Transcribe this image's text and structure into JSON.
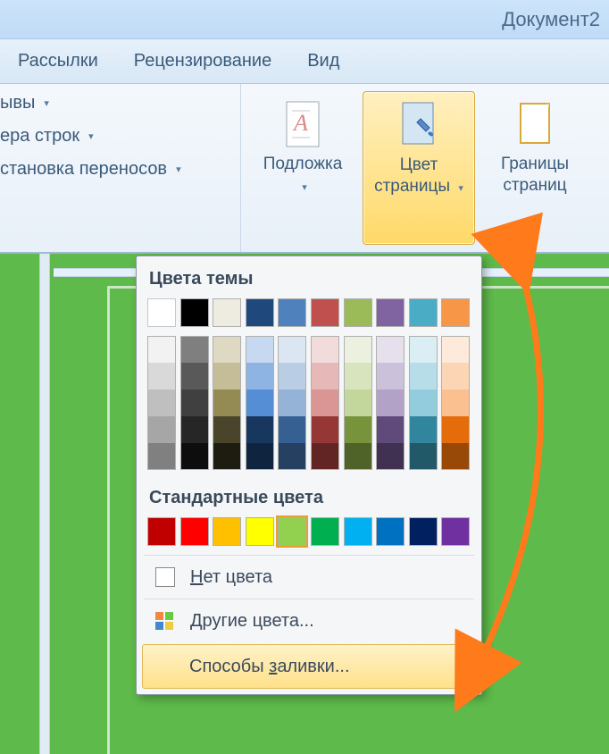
{
  "title": "Документ2",
  "tabs": [
    "Рассылки",
    "Рецензирование",
    "Вид"
  ],
  "ribbon_left": {
    "breaks": "ывы",
    "line_numbers": "ера строк",
    "hyphenation": "становка переносов"
  },
  "ribbon_right": {
    "watermark": "Подложка",
    "page_color": "Цвет\nстраницы",
    "page_borders": "Границы\nстраниц"
  },
  "dropdown": {
    "theme_title": "Цвета темы",
    "standard_title": "Стандартные цвета",
    "no_color_pre": "Н",
    "no_color_rest": "ет цвета",
    "more_pre": "Д",
    "more_rest": "ругие цвета...",
    "fill_pre": "Способы ",
    "fill_u": "з",
    "fill_rest": "аливки...",
    "theme_row": [
      "#ffffff",
      "#000000",
      "#eeece1",
      "#1f497d",
      "#4f81bd",
      "#c0504d",
      "#9bbb59",
      "#8064a2",
      "#4bacc6",
      "#f79646"
    ],
    "standard_row": [
      "#c00000",
      "#ff0000",
      "#ffc000",
      "#ffff00",
      "#92d050",
      "#00b050",
      "#00b0f0",
      "#0070c0",
      "#002060",
      "#7030a0"
    ],
    "selected_standard_index": 4,
    "shades": [
      [
        "#f2f2f2",
        "#d9d9d9",
        "#bfbfbf",
        "#a6a6a6",
        "#808080"
      ],
      [
        "#7f7f7f",
        "#595959",
        "#404040",
        "#262626",
        "#0d0d0d"
      ],
      [
        "#ddd9c3",
        "#c4bd97",
        "#948a54",
        "#4a452a",
        "#1e1c11"
      ],
      [
        "#c6d9f1",
        "#8eb4e3",
        "#558ed5",
        "#17375e",
        "#0f243f"
      ],
      [
        "#dce6f2",
        "#b9cde5",
        "#95b3d7",
        "#376092",
        "#254061"
      ],
      [
        "#f2dcdb",
        "#e6b9b8",
        "#d99694",
        "#953735",
        "#632523"
      ],
      [
        "#ebf1de",
        "#d7e4bd",
        "#c3d69b",
        "#77933c",
        "#4f6228"
      ],
      [
        "#e6e0ec",
        "#ccc1da",
        "#b3a2c7",
        "#604a7b",
        "#403152"
      ],
      [
        "#dbeef4",
        "#b7dee8",
        "#93cddd",
        "#31859c",
        "#215968"
      ],
      [
        "#fdeada",
        "#fcd5b5",
        "#fac090",
        "#e46c0a",
        "#984807"
      ]
    ]
  }
}
